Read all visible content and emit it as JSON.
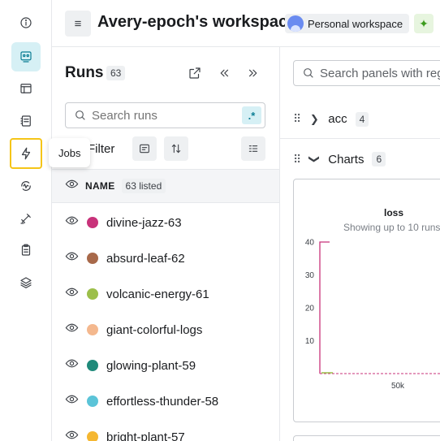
{
  "rail": {
    "items": [
      {
        "name": "info-icon"
      },
      {
        "name": "workspace-icon",
        "active": true
      },
      {
        "name": "table-icon"
      },
      {
        "name": "reports-icon"
      },
      {
        "name": "jobs-icon",
        "highlight": true
      },
      {
        "name": "sweeps-icon"
      },
      {
        "name": "artifacts-icon"
      },
      {
        "name": "clipboard-icon"
      },
      {
        "name": "layers-icon"
      }
    ],
    "tooltip": "Jobs"
  },
  "header": {
    "menu_icon": "≡",
    "title": "Avery-epoch's workspace",
    "badge": "Personal workspace",
    "sparkle_icon": "✦"
  },
  "runs": {
    "title": "Runs",
    "count": "63",
    "search_placeholder": "Search runs",
    "regex_label": ".*",
    "filter_label": "Filter",
    "name_header": "NAME",
    "listed_label": "63 listed",
    "items": [
      {
        "name": "divine-jazz-63",
        "color": "#c8327a"
      },
      {
        "name": "absurd-leaf-62",
        "color": "#a8694a"
      },
      {
        "name": "volcanic-energy-61",
        "color": "#9cbf4a"
      },
      {
        "name": "giant-colorful-logs",
        "color": "#f4b88e"
      },
      {
        "name": "glowing-plant-59",
        "color": "#1f8a7a"
      },
      {
        "name": "effortless-thunder-58",
        "color": "#5bc4d8"
      },
      {
        "name": "bright-plant-57",
        "color": "#f5b731"
      }
    ]
  },
  "panels": {
    "search_placeholder": "Search panels with regex",
    "sections": [
      {
        "label": "acc",
        "count": "4",
        "expanded": false
      },
      {
        "label": "Charts",
        "count": "6",
        "expanded": true
      }
    ]
  },
  "chart_data": {
    "type": "line",
    "title": "loss",
    "subtitle": "Showing up to 10 runs",
    "yticks": [
      10,
      20,
      30,
      40
    ],
    "xticks": [
      "50k"
    ],
    "ylim": [
      0,
      40
    ],
    "colors": {
      "primary": "#c8327a",
      "secondary": "#9cbf4a"
    }
  }
}
